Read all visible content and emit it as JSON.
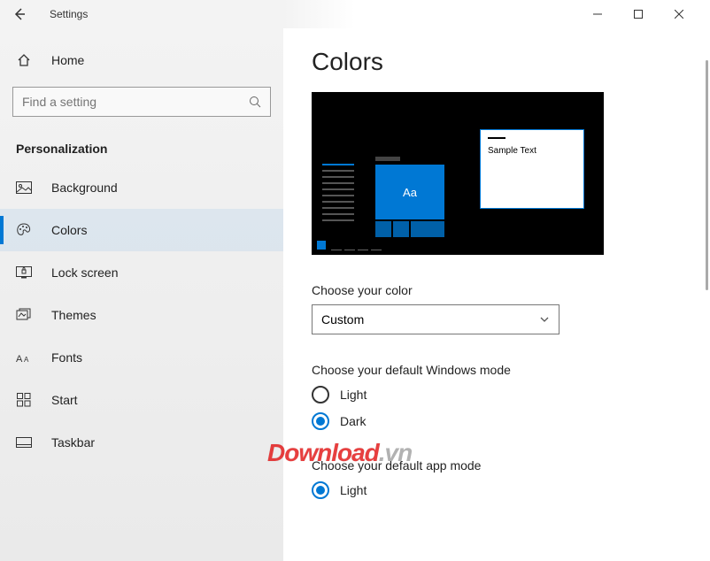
{
  "titlebar": {
    "title": "Settings"
  },
  "sidebar": {
    "home_label": "Home",
    "search_placeholder": "Find a setting",
    "category": "Personalization",
    "items": [
      {
        "key": "background",
        "label": "Background"
      },
      {
        "key": "colors",
        "label": "Colors"
      },
      {
        "key": "lock-screen",
        "label": "Lock screen"
      },
      {
        "key": "themes",
        "label": "Themes"
      },
      {
        "key": "fonts",
        "label": "Fonts"
      },
      {
        "key": "start",
        "label": "Start"
      },
      {
        "key": "taskbar",
        "label": "Taskbar"
      }
    ],
    "active_index": 1
  },
  "main": {
    "heading": "Colors",
    "preview_sample_text": "Sample Text",
    "preview_tile_text": "Aa",
    "choose_color_label": "Choose your color",
    "choose_color_value": "Custom",
    "windows_mode_label": "Choose your default Windows mode",
    "windows_mode_options": [
      "Light",
      "Dark"
    ],
    "windows_mode_selected": "Dark",
    "app_mode_label": "Choose your default app mode",
    "app_mode_options": [
      "Light"
    ],
    "app_mode_selected": "Light"
  },
  "watermark": {
    "red": "Download",
    "gray": ".vn"
  },
  "colors": {
    "accent": "#0078d4"
  }
}
